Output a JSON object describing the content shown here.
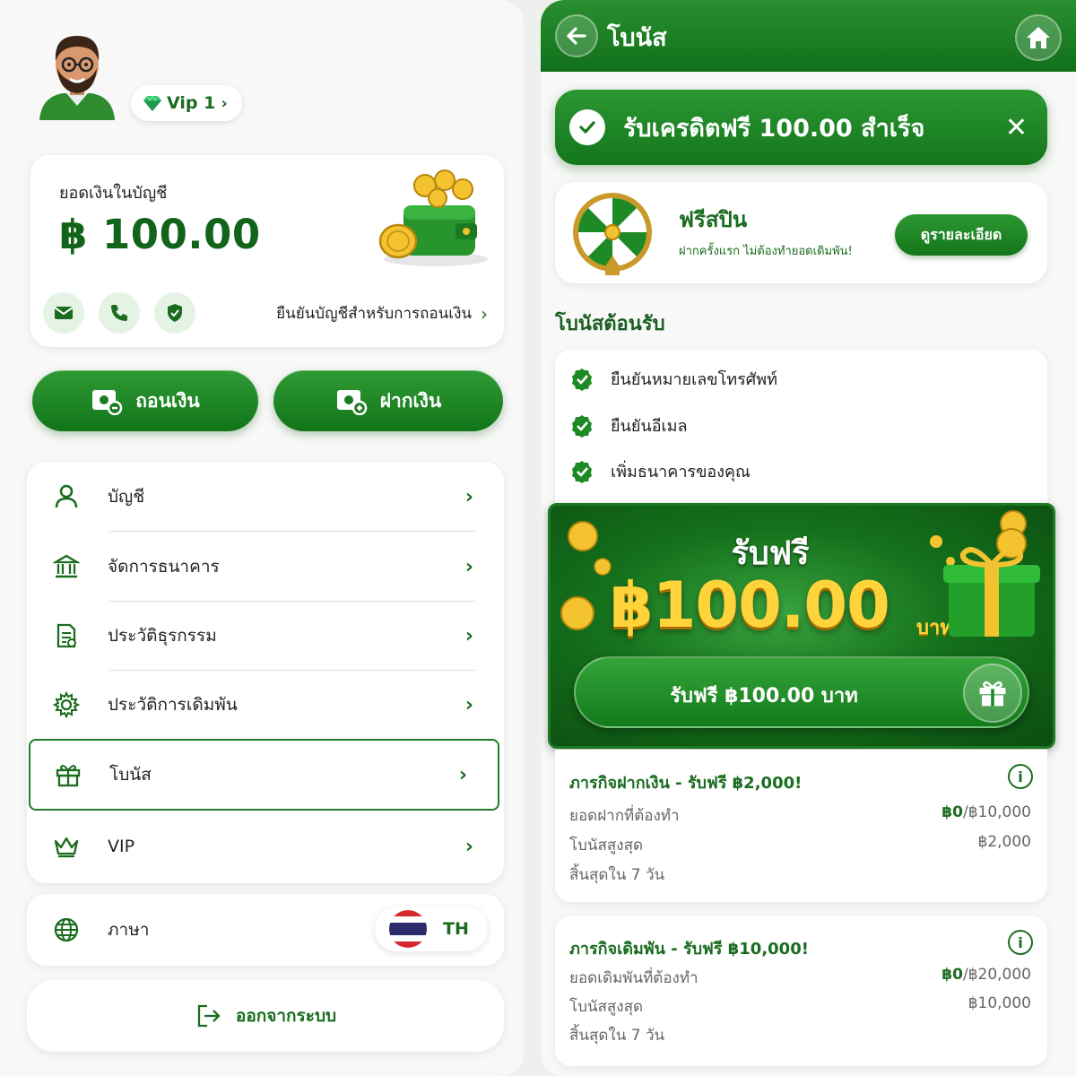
{
  "profile": {
    "vip_label": "Vip 1"
  },
  "balance": {
    "label": "ยอดเงินในบัญชี",
    "amount": "฿ 100.00",
    "verify_link": "ยืนยันบัญชีสำหรับการถอนเงิน"
  },
  "actions": {
    "withdraw": "ถอนเงิน",
    "deposit": "ฝากเงิน"
  },
  "menu": [
    {
      "label": "บัญชี",
      "icon": "user-icon"
    },
    {
      "label": "จัดการธนาคาร",
      "icon": "bank-icon"
    },
    {
      "label": "ประวัติธุรกรรม",
      "icon": "document-icon"
    },
    {
      "label": "ประวัติการเดิมพัน",
      "icon": "gear-icon"
    },
    {
      "label": "โบนัส",
      "icon": "gift-icon",
      "active": true
    },
    {
      "label": "VIP",
      "icon": "crown-icon"
    }
  ],
  "language": {
    "label": "ภาษา",
    "code": "TH"
  },
  "logout": {
    "label": "ออกจากระบบ"
  },
  "header": {
    "title": "โบนัส"
  },
  "toast": {
    "text": "รับเครดิตฟรี 100.00 สำเร็จ"
  },
  "free_spin": {
    "title": "ฟรีสปิน",
    "subtitle": "ฝากครั้งแรก ไม่ต้องทำยอดเดิมพัน!",
    "button": "ดูรายละเอียด"
  },
  "welcome": {
    "title": "โบนัสต้อนรับ",
    "tasks": [
      "ยืนยันหมายเลขโทรศัพท์",
      "ยืนยันอีเมล",
      "เพิ่มธนาคารของคุณ"
    ]
  },
  "promo": {
    "title": "รับฟรี",
    "amount": "฿100.00",
    "unit": "บาท",
    "button": "รับฟรี ฿100.00 บาท"
  },
  "missions": [
    {
      "title": "ภารกิจฝากเงิน - รับฟรี ฿2,000!",
      "rows": [
        {
          "label": "ยอดฝากที่ต้องทำ",
          "current": "฿0",
          "target": "/฿10,000"
        },
        {
          "label": "โบนัสสูงสุด",
          "value": "฿2,000"
        },
        {
          "label": "สิ้นสุดใน 7 วัน"
        }
      ]
    },
    {
      "title": "ภารกิจเดิมพัน - รับฟรี ฿10,000!",
      "rows": [
        {
          "label": "ยอดเดิมพันที่ต้องทำ",
          "current": "฿0",
          "target": "/฿20,000"
        },
        {
          "label": "โบนัสสูงสุด",
          "value": "฿10,000"
        },
        {
          "label": "สิ้นสุดใน 7 วัน"
        }
      ]
    }
  ],
  "colors": {
    "primary": "#1a7a20",
    "primary_dark": "#11701a",
    "gold": "#ffd43a",
    "text_green": "#1a6c1f"
  }
}
